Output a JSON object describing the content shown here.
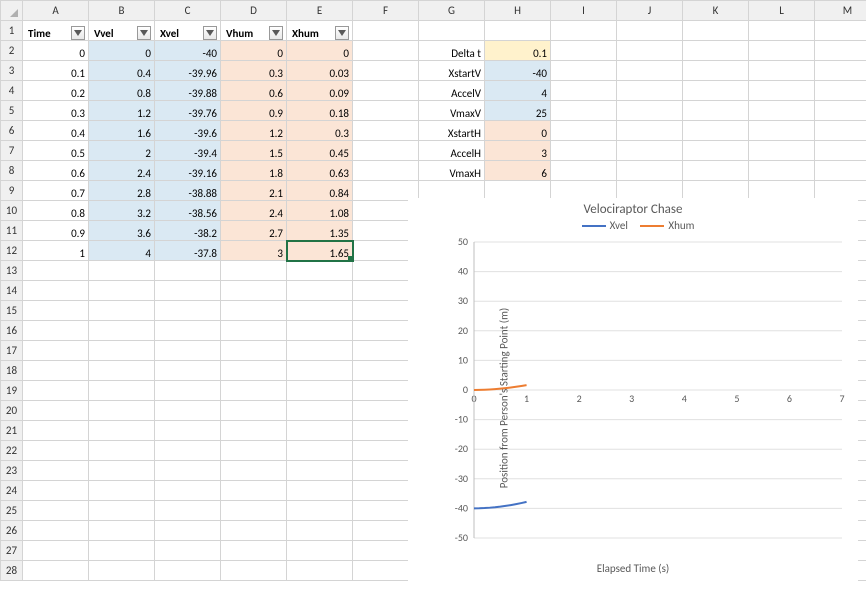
{
  "columns": [
    "A",
    "B",
    "C",
    "D",
    "E",
    "F",
    "G",
    "H",
    "I",
    "J",
    "K",
    "L",
    "M"
  ],
  "visible_rows": 28,
  "headers": {
    "time": "Time",
    "vvel": "Vvel",
    "xvel": "Xvel",
    "vhum": "Vhum",
    "xhum": "Xhum"
  },
  "data_rows": [
    {
      "time": "0",
      "vvel": "0",
      "xvel": "-40",
      "vhum": "0",
      "xhum": "0"
    },
    {
      "time": "0.1",
      "vvel": "0.4",
      "xvel": "-39.96",
      "vhum": "0.3",
      "xhum": "0.03"
    },
    {
      "time": "0.2",
      "vvel": "0.8",
      "xvel": "-39.88",
      "vhum": "0.6",
      "xhum": "0.09"
    },
    {
      "time": "0.3",
      "vvel": "1.2",
      "xvel": "-39.76",
      "vhum": "0.9",
      "xhum": "0.18"
    },
    {
      "time": "0.4",
      "vvel": "1.6",
      "xvel": "-39.6",
      "vhum": "1.2",
      "xhum": "0.3"
    },
    {
      "time": "0.5",
      "vvel": "2",
      "xvel": "-39.4",
      "vhum": "1.5",
      "xhum": "0.45"
    },
    {
      "time": "0.6",
      "vvel": "2.4",
      "xvel": "-39.16",
      "vhum": "1.8",
      "xhum": "0.63"
    },
    {
      "time": "0.7",
      "vvel": "2.8",
      "xvel": "-38.88",
      "vhum": "2.1",
      "xhum": "0.84"
    },
    {
      "time": "0.8",
      "vvel": "3.2",
      "xvel": "-38.56",
      "vhum": "2.4",
      "xhum": "1.08"
    },
    {
      "time": "0.9",
      "vvel": "3.6",
      "xvel": "-38.2",
      "vhum": "2.7",
      "xhum": "1.35"
    },
    {
      "time": "1",
      "vvel": "4",
      "xvel": "-37.8",
      "vhum": "3",
      "xhum": "1.65"
    }
  ],
  "params": [
    {
      "label": "Delta t",
      "value": "0.1",
      "fill": "yellow"
    },
    {
      "label": "XstartV",
      "value": "-40",
      "fill": "blue"
    },
    {
      "label": "AccelV",
      "value": "4",
      "fill": "blue"
    },
    {
      "label": "VmaxV",
      "value": "25",
      "fill": "blue"
    },
    {
      "label": "XstartH",
      "value": "0",
      "fill": "peach"
    },
    {
      "label": "AccelH",
      "value": "3",
      "fill": "peach"
    },
    {
      "label": "VmaxH",
      "value": "6",
      "fill": "peach"
    }
  ],
  "chart_data": {
    "type": "line",
    "title": "Velociraptor Chase",
    "xlabel": "Elapsed Time (s)",
    "ylabel": "Position from Person's Starting Point (m)",
    "xlim": [
      0,
      7
    ],
    "ylim": [
      -50,
      50
    ],
    "xticks": [
      0,
      1,
      2,
      3,
      4,
      5,
      6,
      7
    ],
    "yticks": [
      -50,
      -40,
      -30,
      -20,
      -10,
      0,
      10,
      20,
      30,
      40,
      50
    ],
    "x": [
      0,
      0.1,
      0.2,
      0.3,
      0.4,
      0.5,
      0.6,
      0.7,
      0.8,
      0.9,
      1
    ],
    "series": [
      {
        "name": "Xvel",
        "color": "#4472C4",
        "values": [
          -40,
          -39.96,
          -39.88,
          -39.76,
          -39.6,
          -39.4,
          -39.16,
          -38.88,
          -38.56,
          -38.2,
          -37.8
        ]
      },
      {
        "name": "Xhum",
        "color": "#ED7D31",
        "values": [
          0,
          0.03,
          0.09,
          0.18,
          0.3,
          0.45,
          0.63,
          0.84,
          1.08,
          1.35,
          1.65
        ]
      }
    ]
  }
}
